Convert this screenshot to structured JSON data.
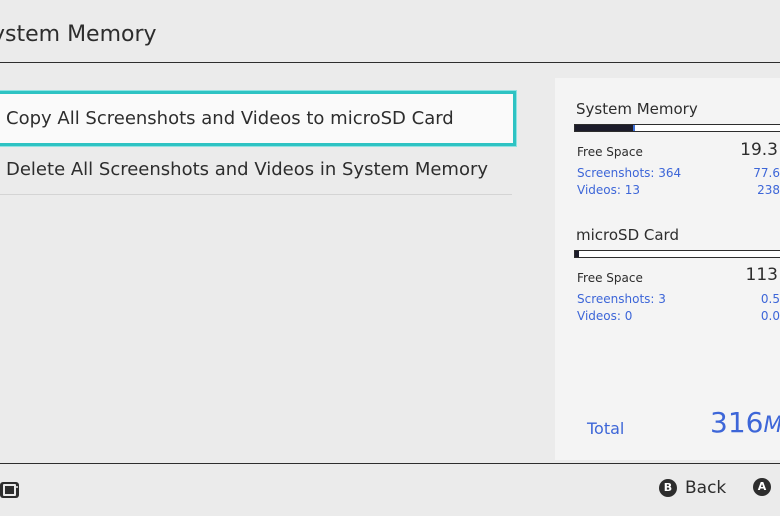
{
  "header": {
    "title": "ystem Memory"
  },
  "menu": {
    "items": [
      {
        "label": "Copy All Screenshots and Videos to microSD Card",
        "selected": true
      },
      {
        "label": "Delete All Screenshots and Videos in System Memory",
        "selected": false
      }
    ]
  },
  "storage": {
    "system_memory": {
      "title": "System Memory",
      "used_fraction": 0.27,
      "free_label": "Free Space",
      "free_value": "19.3",
      "screenshots_label": "Screenshots: 364",
      "screenshots_value": "77.6",
      "videos_label": "Videos: 13",
      "videos_value": "238"
    },
    "microsd": {
      "title": "microSD Card",
      "used_fraction": 0.02,
      "free_label": "Free Space",
      "free_value": "113",
      "screenshots_label": "Screenshots: 3",
      "screenshots_value": "0.5",
      "videos_label": "Videos: 0",
      "videos_value": "0.0"
    },
    "total_label": "Total",
    "total_value": "316",
    "total_unit": "M"
  },
  "footer": {
    "back_label": "Back",
    "back_key": "B",
    "ok_key": "A"
  },
  "colors": {
    "accent_cyan": "#2ec3c3",
    "value_blue": "#3d66d8",
    "background": "#ebebeb"
  },
  "icons": {
    "console": "switch-console-icon"
  }
}
